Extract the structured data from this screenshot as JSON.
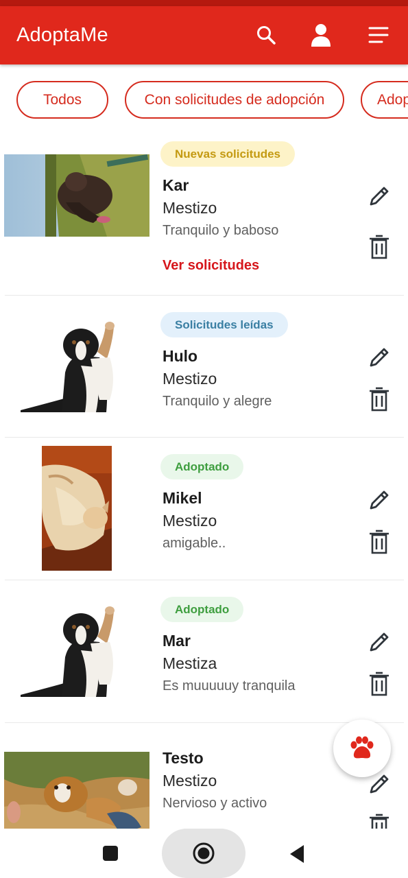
{
  "app": {
    "title": "AdoptaMe"
  },
  "toolbar": {
    "icons": [
      "search-icon",
      "user-icon",
      "menu-icon"
    ]
  },
  "filters": [
    {
      "label": "Todos"
    },
    {
      "label": "Con solicitudes de adopción"
    },
    {
      "label": "Adop"
    }
  ],
  "pets": [
    {
      "status": "Nuevas solicitudes",
      "name": "Kar",
      "breed": "Mestizo",
      "description": "Tranquilo y baboso",
      "action": "Ver solicitudes"
    },
    {
      "status": "Solicitudes leídas",
      "name": "Hulo",
      "breed": "Mestizo",
      "description": "Tranquilo y alegre"
    },
    {
      "status": "Adoptado",
      "name": "Mikel",
      "breed": "Mestizo",
      "description": "amigable.."
    },
    {
      "status": "Adoptado",
      "name": "Mar",
      "breed": "Mestiza",
      "description": "Es muuuuuy tranquila"
    },
    {
      "name": "Testo",
      "breed": "Mestizo",
      "description": "Nervioso y activo"
    }
  ],
  "fab": {
    "icon": "paw-icon"
  },
  "navbar": {
    "icons": [
      "recent-apps-icon",
      "home-icon",
      "back-icon"
    ]
  },
  "colors": {
    "primary": "#e0281c",
    "accent": "#d52b1e",
    "new_badge": "#fdf3c8",
    "read_badge": "#e3f0fb",
    "adopted_badge": "#e9f7ea"
  }
}
